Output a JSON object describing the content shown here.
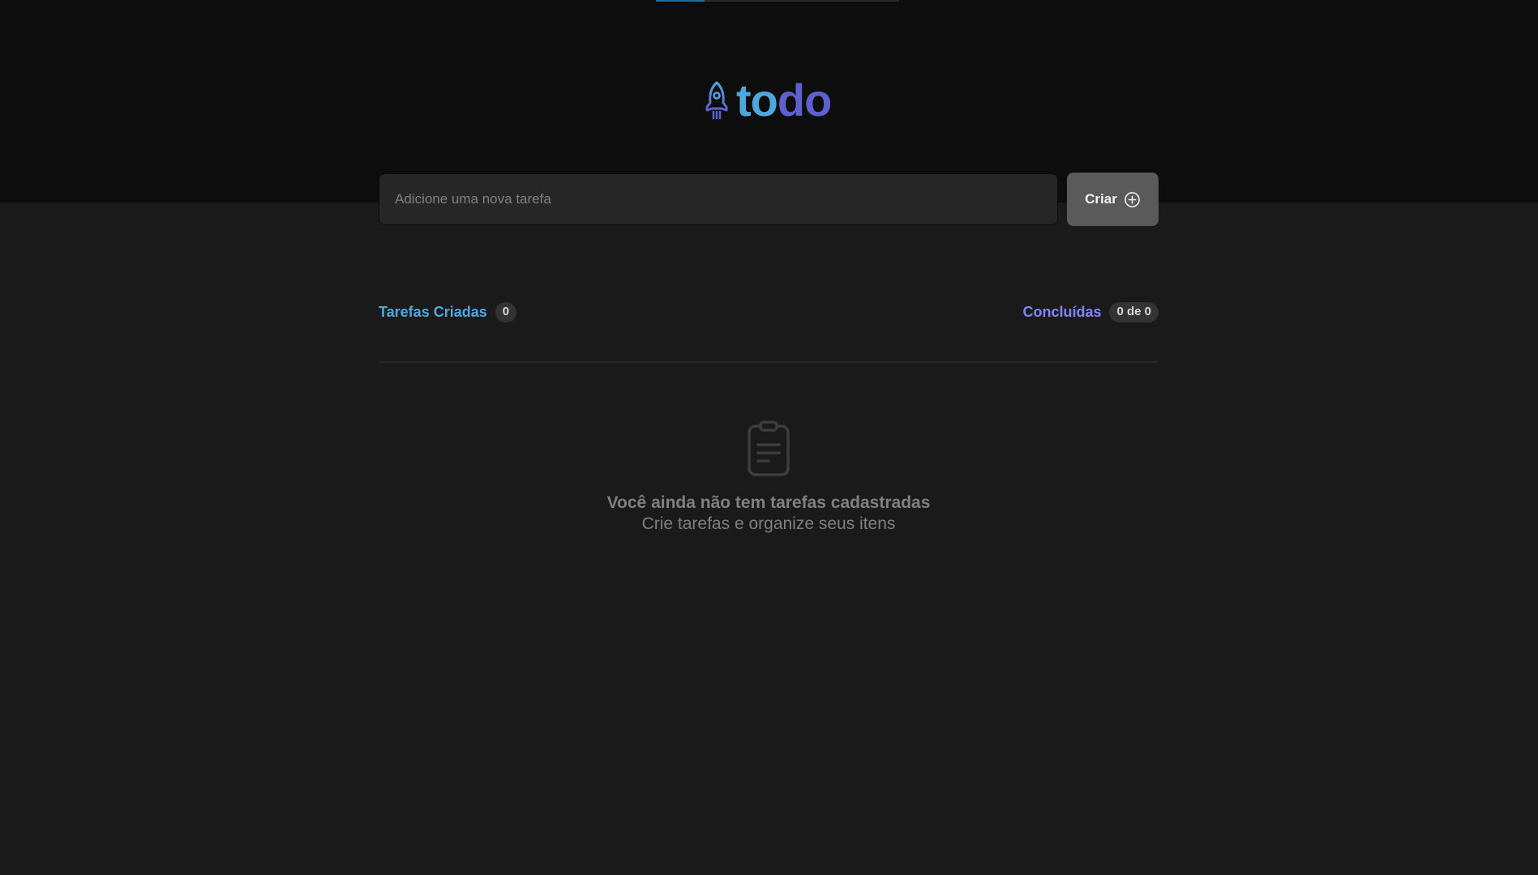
{
  "app": {
    "logo_text_part1": "to",
    "logo_text_part2": "do",
    "logo_icon": "rocket-icon"
  },
  "form": {
    "placeholder": "Adicione uma nova tarefa",
    "value": "",
    "create_label": "Criar",
    "create_icon": "plus-circle-icon"
  },
  "counters": {
    "created_label": "Tarefas Criadas",
    "created_count": "0",
    "done_label": "Concluídas",
    "done_count": "0 de 0"
  },
  "empty_state": {
    "icon": "clipboard-icon",
    "title": "Você ainda não tem tarefas cadastradas",
    "subtitle": "Crie tarefas e organize seus itens"
  },
  "colors": {
    "header_bg": "#0d0d0d",
    "page_bg": "#1a1a1a",
    "blue": "#4ea8de",
    "purple": "#8284fa",
    "logo_purple": "#5e60ce",
    "input_bg": "#262626",
    "button_bg": "#5a5a5a"
  }
}
